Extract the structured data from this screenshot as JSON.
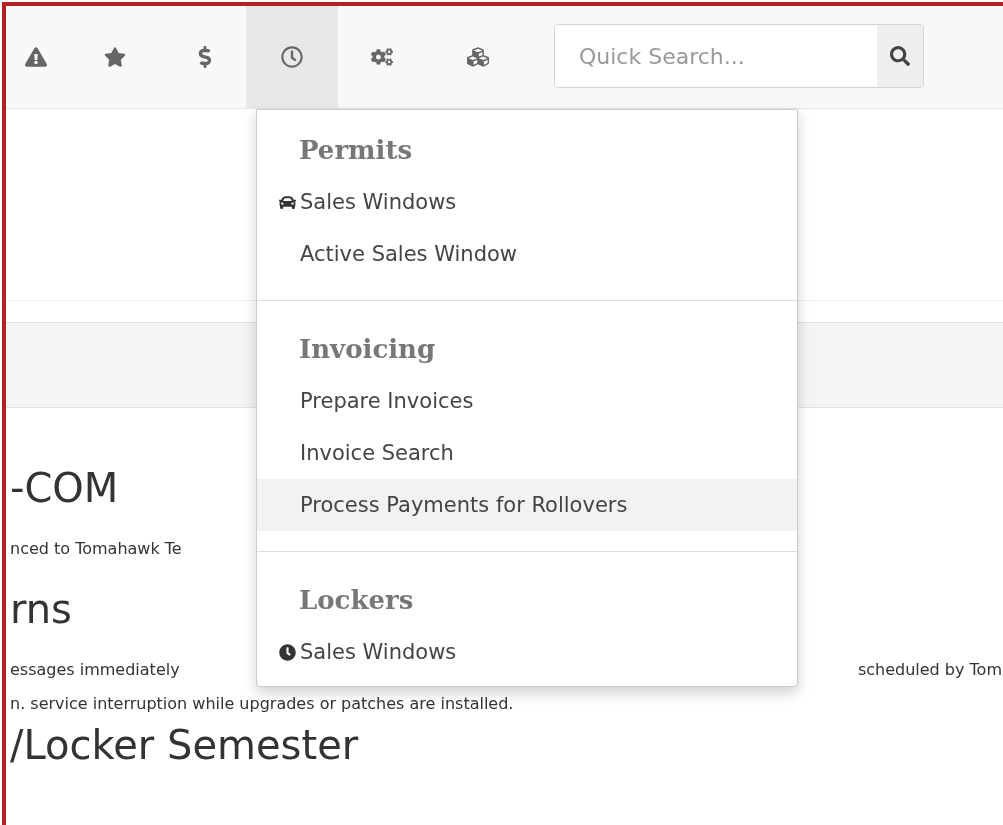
{
  "toolbar": {
    "buttons": [
      {
        "selected": false
      },
      {
        "selected": false
      },
      {
        "selected": false
      },
      {
        "selected": true
      },
      {
        "selected": false
      },
      {
        "selected": false
      }
    ],
    "search": {
      "placeholder": "Quick Search..."
    }
  },
  "menu": {
    "sections": [
      {
        "title": "Permits",
        "items": [
          {
            "label": "Sales Windows",
            "kind": "car",
            "highlighted": false
          },
          {
            "label": "Active Sales Window",
            "kind": "plain",
            "highlighted": false
          }
        ]
      },
      {
        "title": "Invoicing",
        "items": [
          {
            "label": "Prepare Invoices",
            "kind": "plain",
            "highlighted": false
          },
          {
            "label": "Invoice Search",
            "kind": "plain",
            "highlighted": false
          },
          {
            "label": "Process Payments for Rollovers",
            "kind": "plain",
            "highlighted": true
          }
        ]
      },
      {
        "title": "Lockers",
        "items": [
          {
            "label": "Sales Windows",
            "kind": "clock",
            "highlighted": false
          }
        ]
      }
    ]
  },
  "content": {
    "blocks": [
      {
        "kind": "heading",
        "text": "-COM"
      },
      {
        "kind": "text",
        "text": "nced to Tomahawk Te"
      },
      {
        "kind": "heading",
        "text": "rns"
      },
      {
        "kind": "split",
        "left": "essages immediately",
        "right": "scheduled by Tom"
      },
      {
        "kind": "text",
        "text": "n. service interruption while upgrades or patches are installed."
      },
      {
        "kind": "heading",
        "text": "/Locker Semester"
      }
    ]
  }
}
